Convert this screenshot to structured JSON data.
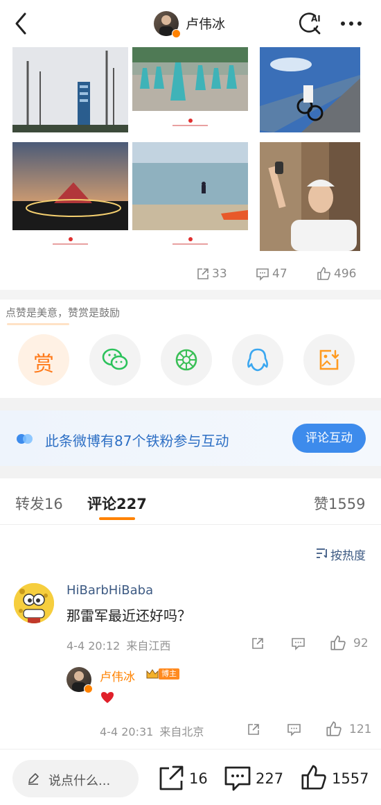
{
  "header": {
    "author_name": "卢伟冰",
    "ai_label": "AI",
    "back_icon": "back-arrow-icon",
    "more_icon": "more-dots-icon"
  },
  "post_stats": {
    "repost": "33",
    "comment": "47",
    "like": "496"
  },
  "reward": {
    "tip_text": "点赞是美意，赞赏是鼓励",
    "reward_label": "赏",
    "share_targets": [
      "wechat-icon",
      "moments-icon",
      "qq-icon",
      "save-image-icon"
    ]
  },
  "fans_banner": {
    "text": "此条微博有87个铁粉参与互动",
    "button": "评论互动"
  },
  "tabs": {
    "repost_label": "转发",
    "repost_count": "16",
    "comment_label": "评论",
    "comment_count": "227",
    "like_label": "赞",
    "like_count": "1559"
  },
  "sort": {
    "label": "按热度"
  },
  "comments": [
    {
      "user": "HiBarbHiBaba",
      "text": "那雷军最近还好吗？",
      "time": "4-4 20:12",
      "location": "来自江西",
      "likes": "92"
    }
  ],
  "reply": {
    "user": "卢伟冰",
    "badge": "博主",
    "content_icon": "red-heart-icon",
    "time": "4-4 20:31",
    "location": "来自北京",
    "likes": "121"
  },
  "bottom_bar": {
    "placeholder": "说点什么...",
    "repost": "16",
    "comment": "227",
    "like": "1557"
  },
  "colors": {
    "accent_orange": "#ff8200",
    "link_blue": "#3d5a83",
    "banner_blue": "#3d8bec"
  }
}
